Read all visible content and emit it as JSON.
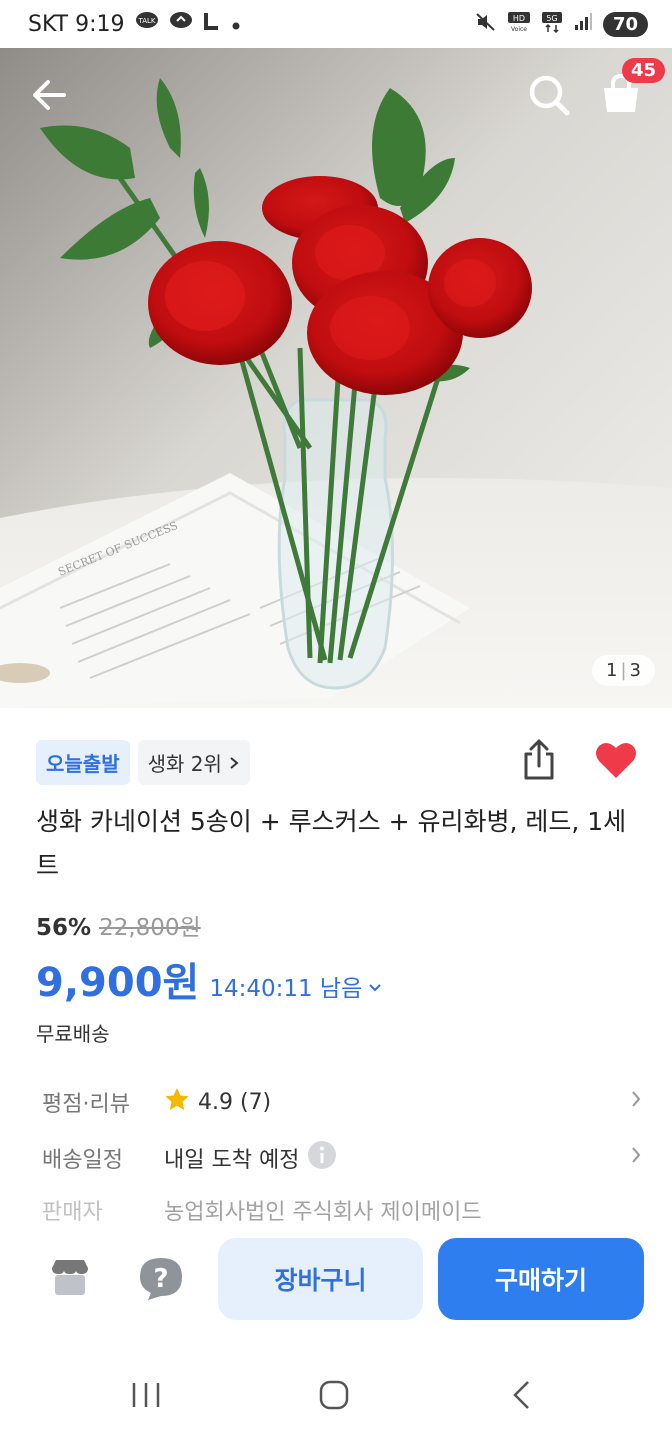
{
  "status_bar": {
    "carrier_time": "SKT 9:19",
    "battery": "70"
  },
  "header": {
    "cart_count": "45"
  },
  "gallery": {
    "current": "1",
    "total": "3"
  },
  "product": {
    "badge_today": "오늘출발",
    "badge_rank": "생화 2위",
    "title": "생화 카네이션 5송이 + 루스커스 + 유리화병, 레드, 1세트",
    "discount": "56%",
    "original_price": "22,800원",
    "price": "9,900원",
    "timer": "14:40:11 남음",
    "shipping": "무료배송"
  },
  "specs": {
    "rating_label": "평점·리뷰",
    "rating_value": "4.9 (7)",
    "delivery_label": "배송일정",
    "delivery_value": "내일 도착 예정",
    "seller_label": "판매자",
    "seller_value": "농업회사법인 주식회사 제이메이드"
  },
  "actions": {
    "cart_label": "장바구니",
    "buy_label": "구매하기"
  },
  "colors": {
    "accent": "#2f7ef0",
    "heart": "#ef3a4a"
  }
}
